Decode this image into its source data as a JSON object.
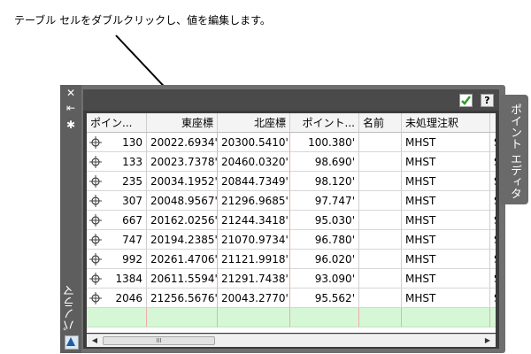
{
  "caption": "テーブル セルをダブルクリックし、値を編集します。",
  "palette": {
    "title": "パノラマ",
    "side_tab": "ポイント エディタ",
    "strip_icons": [
      "close-icon",
      "pin-icon",
      "gear-icon"
    ],
    "toolbar": {
      "apply_icon": "checkmark-icon",
      "help_label": "?"
    }
  },
  "table": {
    "headers": [
      "ポイン...",
      "東座標",
      "北座標",
      "ポイント...",
      "名前",
      "未処理注釈",
      ""
    ],
    "rows": [
      {
        "number": "130",
        "easting": "20022.6934'",
        "northing": "20300.5410'",
        "elevation": "100.380'",
        "name": "",
        "raw": "MHST",
        "extra": "S"
      },
      {
        "number": "133",
        "easting": "20023.7378'",
        "northing": "20460.0320'",
        "elevation": "98.690'",
        "name": "",
        "raw": "MHST",
        "extra": "S"
      },
      {
        "number": "235",
        "easting": "20034.1952'",
        "northing": "20844.7349'",
        "elevation": "98.120'",
        "name": "",
        "raw": "MHST",
        "extra": "S"
      },
      {
        "number": "307",
        "easting": "20048.9567'",
        "northing": "21296.9685'",
        "elevation": "97.747'",
        "name": "",
        "raw": "MHST",
        "extra": "S"
      },
      {
        "number": "667",
        "easting": "20162.0256'",
        "northing": "21244.3418'",
        "elevation": "95.030'",
        "name": "",
        "raw": "MHST",
        "extra": "S"
      },
      {
        "number": "747",
        "easting": "20194.2385'",
        "northing": "21070.9734'",
        "elevation": "96.780'",
        "name": "",
        "raw": "MHST",
        "extra": "S"
      },
      {
        "number": "992",
        "easting": "20261.4706'",
        "northing": "21121.9918'",
        "elevation": "96.020'",
        "name": "",
        "raw": "MHST",
        "extra": "S"
      },
      {
        "number": "1384",
        "easting": "20611.5594'",
        "northing": "21291.7438'",
        "elevation": "93.090'",
        "name": "",
        "raw": "MHST",
        "extra": "S"
      },
      {
        "number": "2046",
        "easting": "21256.5676'",
        "northing": "20043.2770'",
        "elevation": "95.562'",
        "name": "",
        "raw": "MHST",
        "extra": "S"
      }
    ]
  },
  "scrollbar": {
    "thumb_grip": "III"
  },
  "colors": {
    "new_row": "#d6f7d6",
    "frame": "#6f6f6f",
    "apply": "#2e9b2e"
  }
}
